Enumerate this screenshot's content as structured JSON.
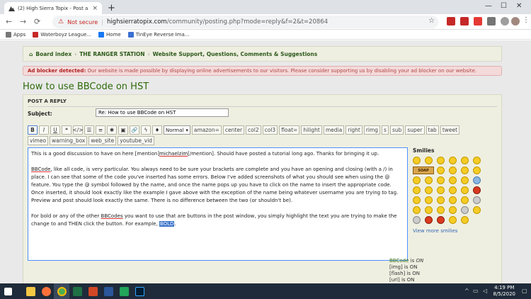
{
  "browser": {
    "tab_title": "(2) High Sierra Topix - Post a repl",
    "tab_close": "×",
    "new_tab": "+",
    "not_secure": "Not secure",
    "url_domain": "highsierratopix.com",
    "url_path": "/community/posting.php?mode=reply&f=2&t=20864",
    "bookmarks": [
      {
        "label": "Apps",
        "color": "#777777"
      },
      {
        "label": "Waterboyz League...",
        "color": "#c62828"
      },
      {
        "label": "Home",
        "color": "#1877f2"
      },
      {
        "label": "TinEye Reverse Ima...",
        "color": "#3b6fd1"
      }
    ]
  },
  "breadcrumb": {
    "home": "Board index",
    "item1": "THE RANGER STATION",
    "item2": "Website Support, Questions, Comments & Suggestions",
    "separator": "‹"
  },
  "adblock": {
    "bold": "Ad blocker detected:",
    "text": " Our website is made possible by displaying online advertisements to our visitors. Please consider supporting us by disabling your ad blocker on our website."
  },
  "page_title": "How to use BBCode on HST",
  "form": {
    "header": "POST A REPLY",
    "subject_label": "Subject:",
    "subject_value": "Re: How to use BBCode on HST",
    "size_select": "Normal",
    "tag_buttons_row1": [
      "amazon=",
      "center",
      "col2",
      "col3",
      "float=",
      "hilight",
      "media",
      "right",
      "rimg",
      "s",
      "sub",
      "super",
      "tab",
      "tweet"
    ],
    "tag_buttons_row2": [
      "vimeo",
      "warning_box",
      "web_site",
      "youtube_vid"
    ]
  },
  "editor": {
    "p1_a": "This is a good discussion to have on here [mention]",
    "p1_u": "michaelzim",
    "p1_b": "[/mention]. Should have posted a tutorial long ago. Thanks for bringing it up.",
    "p2_u": "BBCode",
    "p2_rest": ", like all code, is very particular. You always need to be sure your brackets are complete and you have an opening and closing (with a /) in place. I can see that some of the code you've inserted has some errors. Below I've added screenshots of what you should see when using the @ feature. You type the @ symbol followed by the name, and once the name pops up you have to click on the name to insert the appropriate code. Once inserted, it should look exactly like the example I gave above with the exception of the name being whatever username you are trying to tag. Preview and post should look exactly the same. There is no difference between the two (or shouldn't be).",
    "p3_a": "For bold or any of the other ",
    "p3_u": "BBCodes",
    "p3_b": " you want to use that are buttons in the post window, you simply highlight the text you are trying to make the change to and THEN click the button. For example, ",
    "p3_hl": "BOLD",
    "p3_c": "."
  },
  "smilies": {
    "label": "Smilies",
    "soap": "SOAP",
    "view_more": "View more smilies"
  },
  "bbinfo": {
    "l1_a": "BBCode",
    "l1_b": " is ",
    "l1_c": "ON",
    "l2": "[img] is ON",
    "l3": "[flash] is ON",
    "l4": "[url] is ON"
  },
  "clock": {
    "time": "4:19 PM",
    "date": "8/5/2020"
  }
}
